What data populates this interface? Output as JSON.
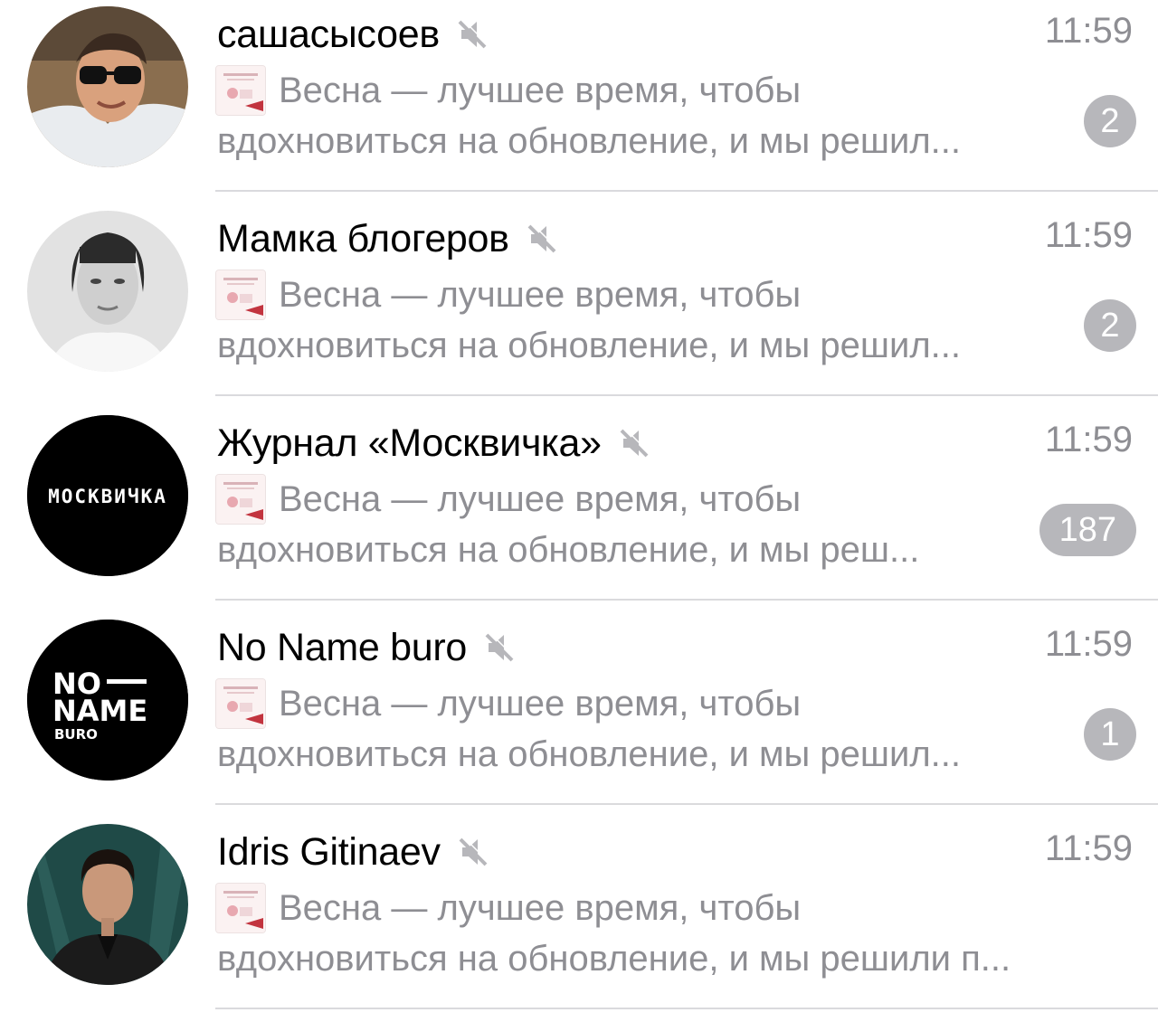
{
  "chats": [
    {
      "name": "сашасысоев",
      "time": "11:59",
      "preview_line1": "Весна — лучшее время, чтобы",
      "preview_line2": "вдохновиться на обновление, и мы решил...",
      "unread": "2",
      "muted": true,
      "avatar": "photo-man-sunglasses"
    },
    {
      "name": "Мамка блогеров",
      "time": "11:59",
      "preview_line1": "Весна — лучшее время, чтобы",
      "preview_line2": "вдохновиться на обновление, и мы решил...",
      "unread": "2",
      "muted": true,
      "avatar": "photo-woman-bw"
    },
    {
      "name": "Журнал «Москвичка»",
      "time": "11:59",
      "preview_line1": "Весна — лучшее время, чтобы",
      "preview_line2": "вдохновиться на обновление, и мы реш...",
      "unread": "187",
      "muted": true,
      "avatar": "logo-moskvichka",
      "avatar_text": "МОСКВИЧКА"
    },
    {
      "name": "No Name buro",
      "time": "11:59",
      "preview_line1": "Весна — лучшее время, чтобы",
      "preview_line2": "вдохновиться на обновление, и мы решил...",
      "unread": "1",
      "muted": true,
      "avatar": "logo-no-name-buro",
      "avatar_text_1": "NO",
      "avatar_text_2": "NAME",
      "avatar_text_3": "BURO"
    },
    {
      "name": "Idris Gitinaev",
      "time": "11:59",
      "preview_line1": "Весна — лучшее время, чтобы",
      "preview_line2": "вдохновиться на обновление, и мы решили п...",
      "unread": "",
      "muted": true,
      "avatar": "photo-man-dark-suit"
    }
  ],
  "colors": {
    "name": "#000000",
    "secondary": "#8e8e93",
    "badge": "#b7b7bb",
    "separator": "#dadadd"
  }
}
